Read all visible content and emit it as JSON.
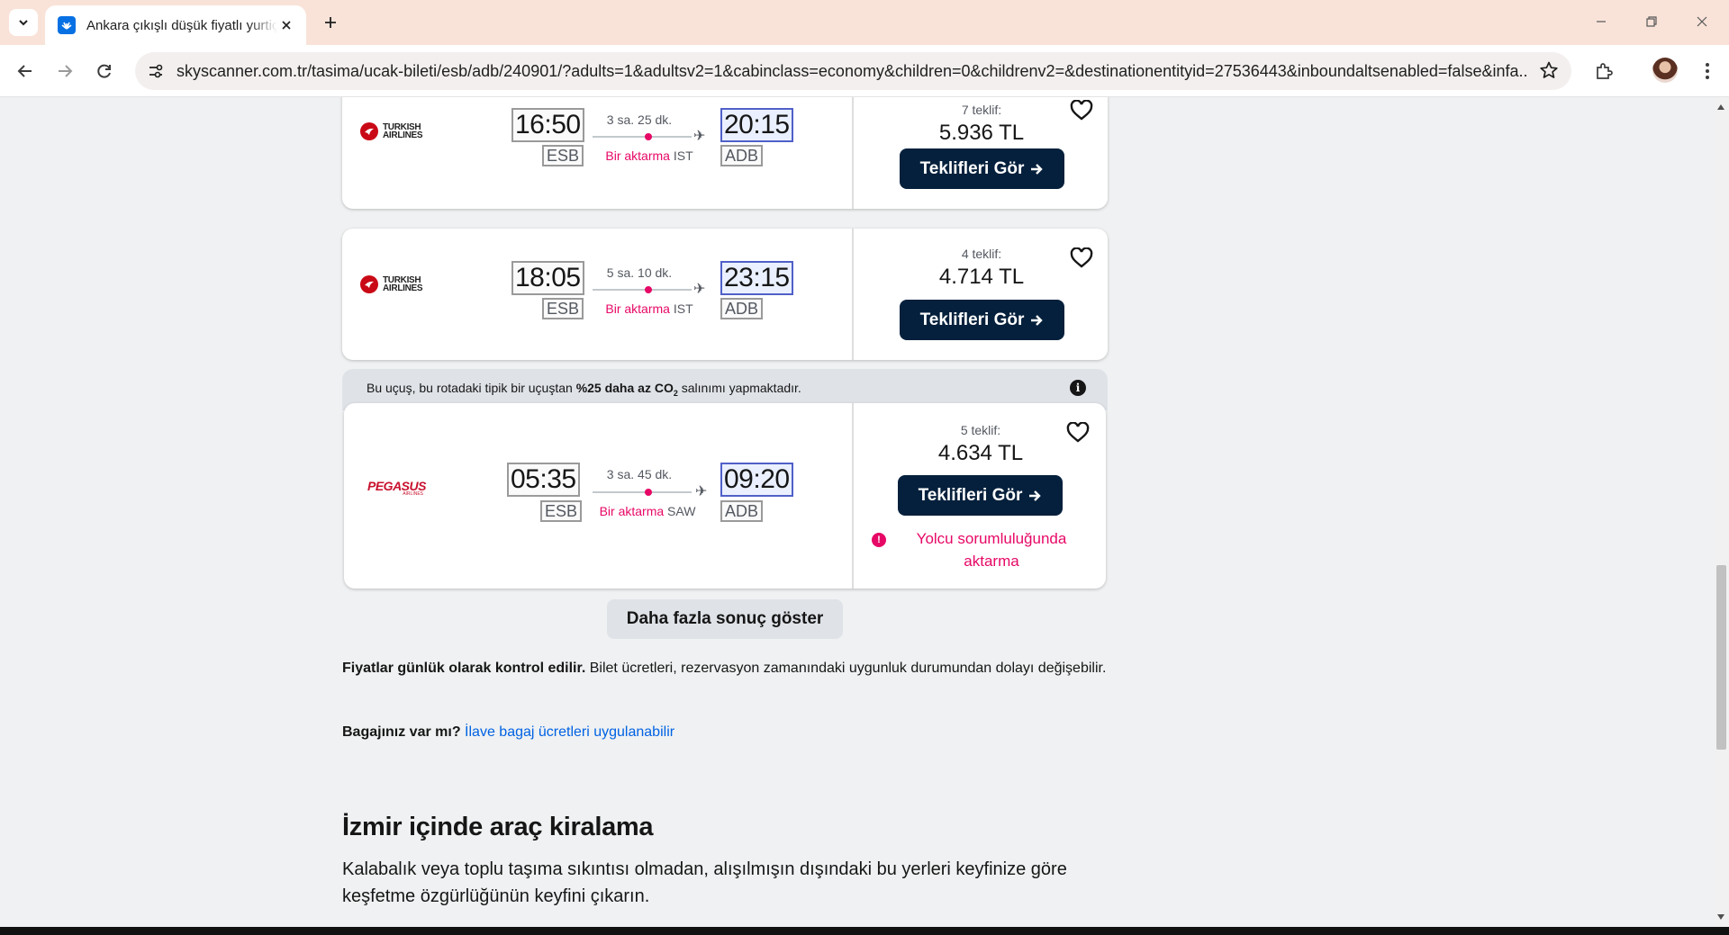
{
  "browser": {
    "tab_title": "Ankara çıkışlı düşük fiyatlı yurtiçi",
    "url": "skyscanner.com.tr/tasima/ucak-bileti/esb/adb/240901/?adults=1&adultsv2=1&cabinclass=economy&children=0&childrenv2=&destinationentityid=27536443&inboundaltsenabled=false&infa..."
  },
  "flights": [
    {
      "airline": "TURKISH AIRLINES",
      "airline_line1": "TURKISH",
      "airline_line2": "AIRLINES",
      "depart_time": "16:50",
      "arrive_time": "20:15",
      "from_code": "ESB",
      "to_code": "ADB",
      "duration": "3 sa. 25 dk.",
      "stops_label": "Bir aktarma",
      "via": "IST",
      "deals": "7 teklif:",
      "price": "5.936 TL",
      "button": "Teklifleri Gör"
    },
    {
      "airline": "TURKISH AIRLINES",
      "airline_line1": "TURKISH",
      "airline_line2": "AIRLINES",
      "depart_time": "18:05",
      "arrive_time": "23:15",
      "from_code": "ESB",
      "to_code": "ADB",
      "duration": "5 sa. 10 dk.",
      "stops_label": "Bir aktarma",
      "via": "IST",
      "deals": "4 teklif:",
      "price": "4.714 TL",
      "button": "Teklifleri Gör"
    },
    {
      "airline": "PEGASUS",
      "airline_sub": "AIRLINES",
      "depart_time": "05:35",
      "arrive_time": "09:20",
      "from_code": "ESB",
      "to_code": "ADB",
      "duration": "3 sa. 45 dk.",
      "stops_label": "Bir aktarma",
      "via": "SAW",
      "deals": "5 teklif:",
      "price": "4.634 TL",
      "button": "Teklifleri Gör",
      "warning": "Yolcu sorumluluğunda aktarma"
    }
  ],
  "eco_banner": {
    "prefix": "Bu uçuş, bu rotadaki tipik bir uçuştan ",
    "bold": "%25 daha az CO",
    "sub": "2",
    "suffix": " salınımı yapmaktadır."
  },
  "more_results": "Daha fazla sonuç göster",
  "price_note": {
    "bold": "Fiyatlar günlük olarak kontrol edilir.",
    "text": " Bilet ücretleri, rezervasyon zamanındaki uygunluk durumundan dolayı değişebilir."
  },
  "baggage": {
    "bold": "Bagajınız var mı?",
    "link": "İlave bagaj ücretleri uygulanabilir"
  },
  "car_hire": {
    "title": "İzmir içinde araç kiralama",
    "text": "Kalabalık veya toplu taşıma sıkıntısı olmadan, alışılmışın dışındaki bu yerleri keyfinize göre keşfetme özgürlüğünün keyfini çıkarın."
  },
  "colors": {
    "accent_pink": "#e70866",
    "button_navy": "#05203c",
    "link_blue": "#0062e3",
    "tab_bar": "#f9e3d9"
  }
}
